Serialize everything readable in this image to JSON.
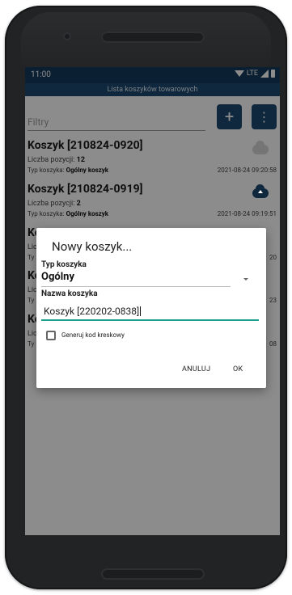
{
  "status_bar": {
    "time": "11:00",
    "network": "LTE"
  },
  "app_bar": {
    "title": "Lista koszyków towarowych"
  },
  "toolbar": {
    "filter_placeholder": "Filtry",
    "add_label": "+",
    "more_label": "⋮"
  },
  "baskets": [
    {
      "title": "Koszyk [210824-0920]",
      "count_label": "Liczba pozycji:",
      "count": "12",
      "type_label": "Typ koszyka:",
      "type": "Ogólny koszyk",
      "date": "2021-08-24 09:20:58",
      "sync_icon": "cloud-icon"
    },
    {
      "title": "Koszyk [210824-0919]",
      "count_label": "Liczba pozycji:",
      "count": "2",
      "type_label": "Typ koszyka:",
      "type": "Ogólny koszyk",
      "date": "2021-08-24 09:19:51",
      "sync_icon": "cloud-upload-icon"
    }
  ],
  "partial_rows": {
    "row3": {
      "title_fragment": "Ko",
      "count_fragment": "Lic",
      "type_fragment": "Ty",
      "date_fragment": "20"
    },
    "row4": {
      "title_fragment": "Ko",
      "count_fragment": "Lic",
      "type_fragment": "Ty",
      "date_fragment": "23"
    },
    "row5": {
      "title_fragment": "Ko",
      "count_fragment": "Lic",
      "type_fragment": "Ty",
      "date_fragment": "08"
    }
  },
  "dialog": {
    "title": "Nowy koszyk...",
    "type_label": "Typ koszyka",
    "type_value": "Ogólny",
    "name_label": "Nazwa koszyka",
    "name_value": "Koszyk [220202-0838]",
    "checkbox_label": "Generuj kod kreskowy",
    "checkbox_checked": false,
    "cancel_label": "ANULUJ",
    "ok_label": "OK"
  },
  "colors": {
    "primary": "#1d4971",
    "status_bar": "#153a5c",
    "accent": "#1a9f8d"
  }
}
